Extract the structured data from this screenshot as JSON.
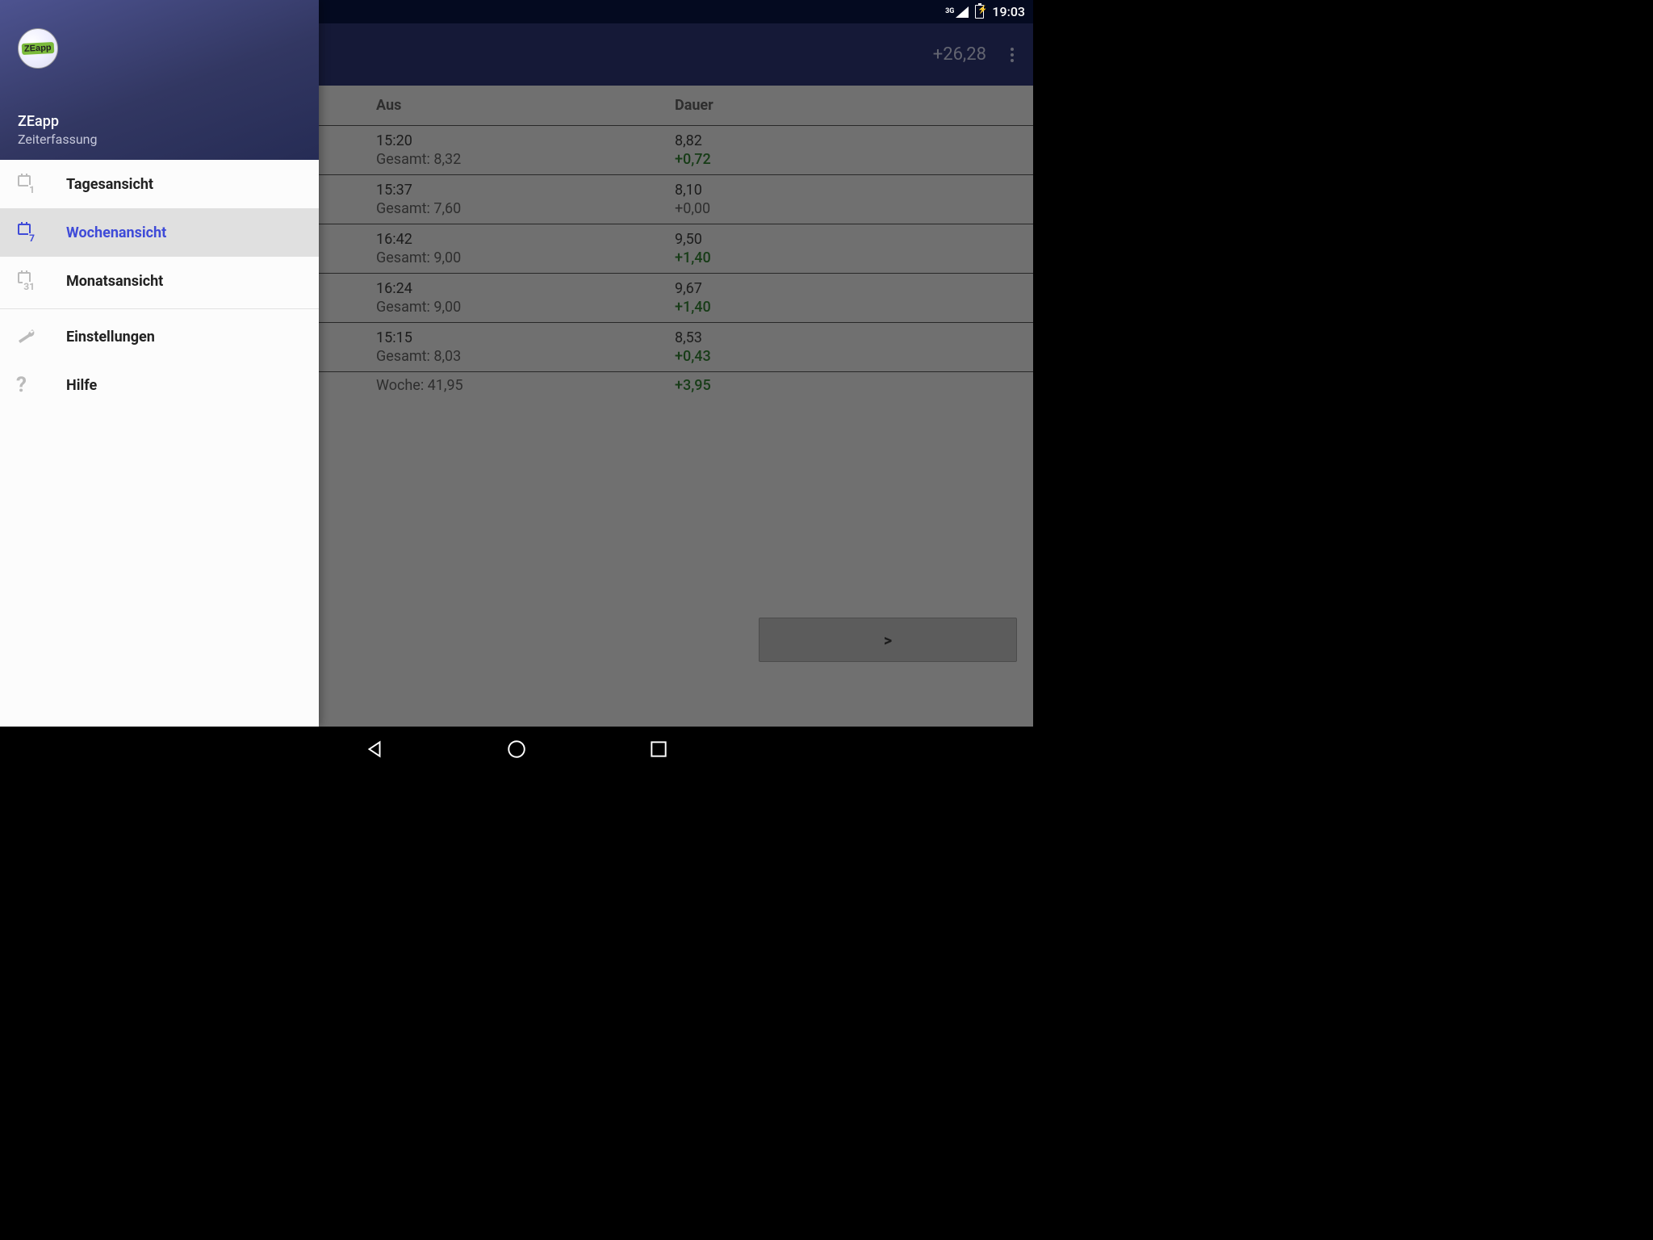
{
  "status": {
    "network_label": "3G",
    "time": "19:03"
  },
  "app_bar": {
    "balance": "+26,28"
  },
  "drawer": {
    "app_name": "ZEapp",
    "app_subtitle": "Zeiterfassung",
    "logo_text": "ZEapp",
    "items": [
      {
        "icon_num": "1",
        "label": "Tagesansicht",
        "type": "calendar",
        "active": false
      },
      {
        "icon_num": "7",
        "label": "Wochenansicht",
        "type": "calendar",
        "active": true
      },
      {
        "icon_num": "31",
        "label": "Monatsansicht",
        "type": "calendar",
        "active": false
      }
    ],
    "secondary": [
      {
        "label": "Einstellungen",
        "icon": "wrench"
      },
      {
        "label": "Hilfe",
        "icon": "question"
      }
    ]
  },
  "table": {
    "headers": {
      "col_aus": "Aus",
      "col_dauer": "Dauer"
    },
    "rows": [
      {
        "aus": "15:20",
        "gesamt_label": "Gesamt: 8,32",
        "dauer": "8,82",
        "delta": "+0,72",
        "delta_positive": true
      },
      {
        "aus": "15:37",
        "gesamt_label": "Gesamt: 7,60",
        "dauer": "8,10",
        "delta": "+0,00",
        "delta_positive": false
      },
      {
        "aus": "16:42",
        "gesamt_label": "Gesamt: 9,00",
        "dauer": "9,50",
        "delta": "+1,40",
        "delta_positive": true
      },
      {
        "aus": "16:24",
        "gesamt_label": "Gesamt: 9,00",
        "dauer": "9,67",
        "delta": "+1,40",
        "delta_positive": true
      },
      {
        "aus": "15:15",
        "gesamt_label": "Gesamt: 8,03",
        "dauer": "8,53",
        "delta": "+0,43",
        "delta_positive": true
      }
    ],
    "week_summary": {
      "label": "Woche: 41,95",
      "delta": "+3,95",
      "delta_positive": true
    }
  },
  "forward_button": ">"
}
